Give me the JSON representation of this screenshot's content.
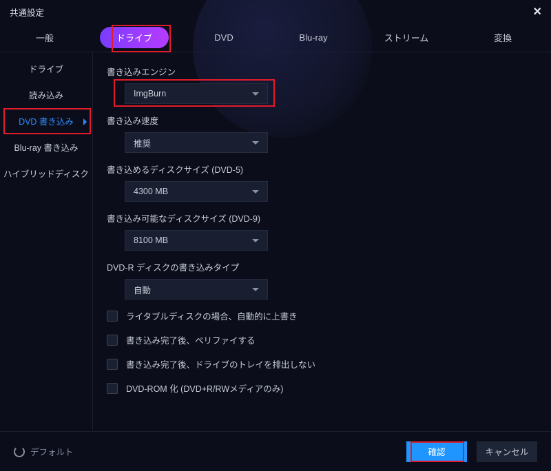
{
  "title": "共通設定",
  "tabs": [
    "一般",
    "ドライブ",
    "DVD",
    "Blu-ray",
    "ストリーム",
    "変換"
  ],
  "active_tab": 1,
  "sidebar": {
    "items": [
      {
        "label": "ドライブ"
      },
      {
        "label": "読み込み"
      },
      {
        "label": "DVD 書き込み"
      },
      {
        "label": "Blu-ray 書き込み"
      },
      {
        "label": "ハイブリッドディスク"
      }
    ],
    "active_index": 2
  },
  "fields": {
    "engine": {
      "label": "書き込みエンジン",
      "value": "ImgBurn"
    },
    "speed": {
      "label": "書き込み速度",
      "value": "推奨"
    },
    "dvd5": {
      "label": "書き込めるディスクサイズ (DVD-5)",
      "value": "4300 MB"
    },
    "dvd9": {
      "label": "書き込み可能なディスクサイズ (DVD-9)",
      "value": "8100 MB"
    },
    "dvdrtype": {
      "label": "DVD-R ディスクの書き込みタイプ",
      "value": "自動"
    }
  },
  "checks": {
    "overwrite": {
      "label": "ライタブルディスクの場合、自動的に上書き",
      "checked": false
    },
    "verify": {
      "label": "書き込み完了後、ベリファイする",
      "checked": false
    },
    "eject": {
      "label": "書き込み完了後、ドライブのトレイを排出しない",
      "checked": false
    },
    "dvdrom": {
      "label": "DVD-ROM 化 (DVD+R/RWメディアのみ)",
      "checked": false
    }
  },
  "footer": {
    "default": "デフォルト",
    "ok": "確認",
    "cancel": "キャンセル"
  }
}
